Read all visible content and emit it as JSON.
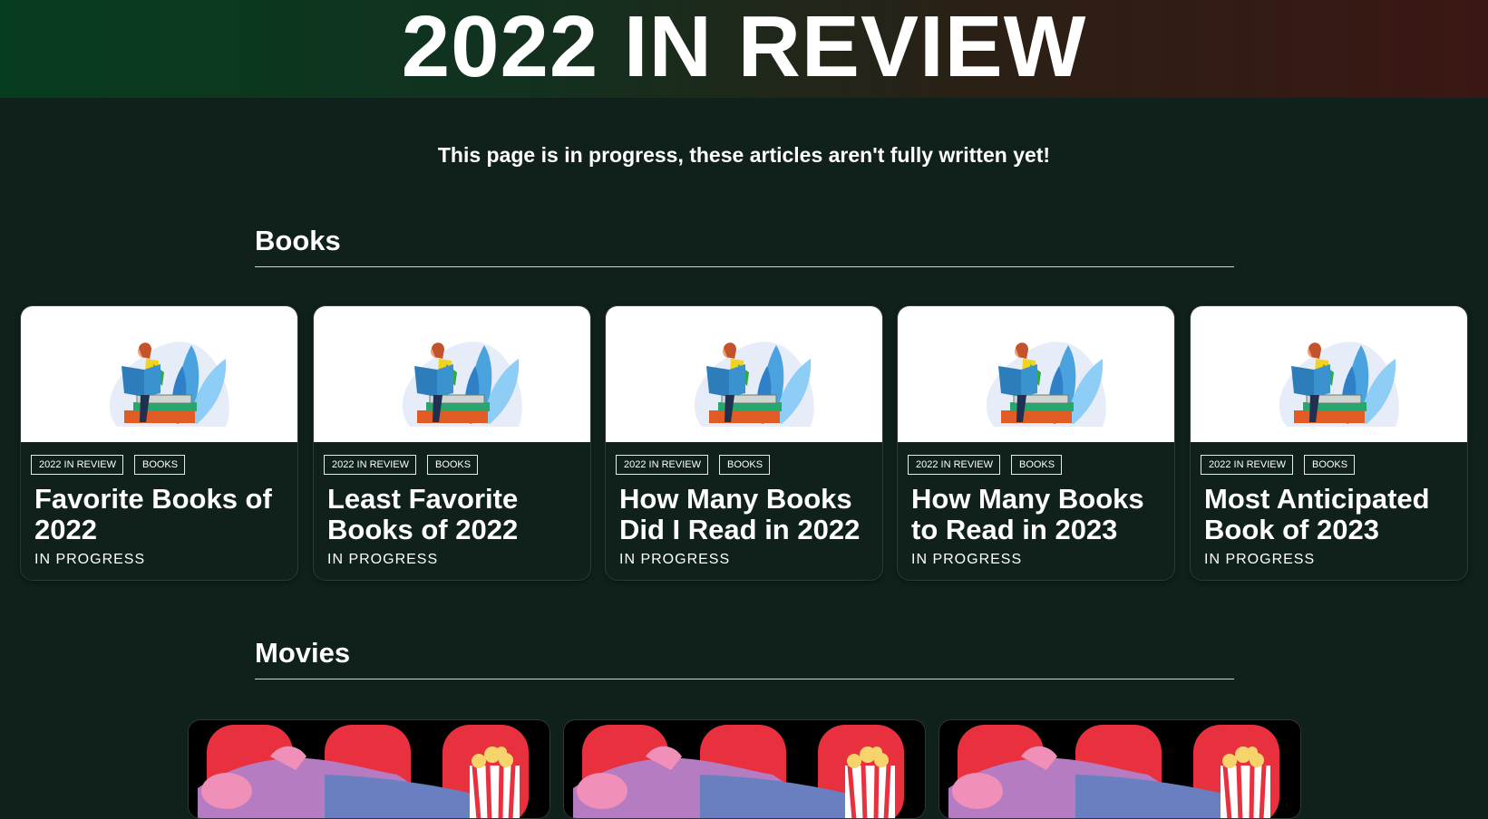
{
  "header": {
    "title": "2022 IN REVIEW"
  },
  "notice": "This page is in progress, these articles aren't fully written yet!",
  "sections": {
    "books": {
      "heading": "Books",
      "cards": [
        {
          "tags": [
            "2022 IN REVIEW",
            "BOOKS"
          ],
          "title": "Favorite Books of 2022",
          "status": "IN PROGRESS"
        },
        {
          "tags": [
            "2022 IN REVIEW",
            "BOOKS"
          ],
          "title": "Least Favorite Books of 2022",
          "status": "IN PROGRESS"
        },
        {
          "tags": [
            "2022 IN REVIEW",
            "BOOKS"
          ],
          "title": "How Many Books Did I Read in 2022",
          "status": "IN PROGRESS"
        },
        {
          "tags": [
            "2022 IN REVIEW",
            "BOOKS"
          ],
          "title": "How Many Books to Read in 2023",
          "status": "IN PROGRESS"
        },
        {
          "tags": [
            "2022 IN REVIEW",
            "BOOKS"
          ],
          "title": "Most Anticipated Book of 2023",
          "status": "IN PROGRESS"
        }
      ]
    },
    "movies": {
      "heading": "Movies",
      "card_count": 3
    }
  },
  "colors": {
    "background": "#0f211a",
    "banner_left": "#073d1f",
    "banner_right": "#3b1714",
    "text": "#ffffff"
  },
  "icons": {
    "book_thumb": "reading-person-illustration",
    "movie_thumb": "cinema-popcorn-illustration"
  }
}
